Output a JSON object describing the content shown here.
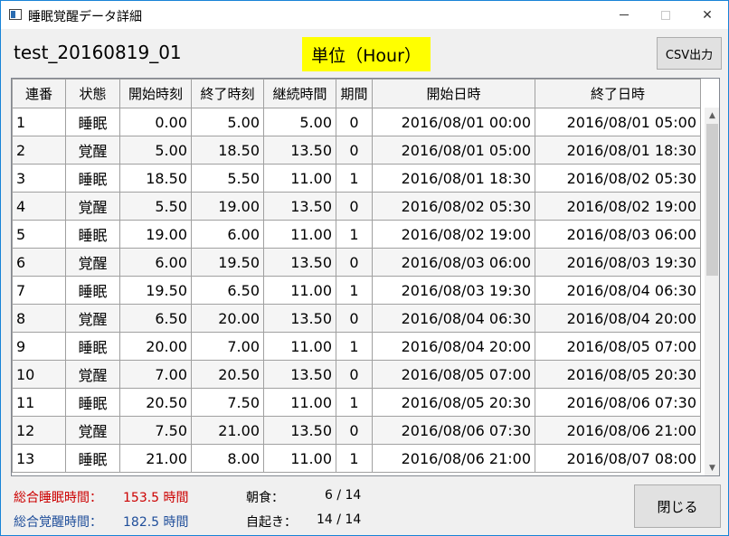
{
  "window": {
    "title": "睡眠覚醒データ詳細",
    "close_glyph": "✕"
  },
  "header": {
    "test_name": "test_20160819_01",
    "unit": "単位（Hour）",
    "csv_button": "CSV出力"
  },
  "table": {
    "columns": [
      "連番",
      "状態",
      "開始時刻",
      "終了時刻",
      "継続時間",
      "期間",
      "開始日時",
      "終了日時"
    ],
    "rows": [
      [
        "1",
        "睡眠",
        "0.00",
        "5.00",
        "5.00",
        "0",
        "2016/08/01 00:00",
        "2016/08/01 05:00"
      ],
      [
        "2",
        "覚醒",
        "5.00",
        "18.50",
        "13.50",
        "0",
        "2016/08/01 05:00",
        "2016/08/01 18:30"
      ],
      [
        "3",
        "睡眠",
        "18.50",
        "5.50",
        "11.00",
        "1",
        "2016/08/01 18:30",
        "2016/08/02 05:30"
      ],
      [
        "4",
        "覚醒",
        "5.50",
        "19.00",
        "13.50",
        "0",
        "2016/08/02 05:30",
        "2016/08/02 19:00"
      ],
      [
        "5",
        "睡眠",
        "19.00",
        "6.00",
        "11.00",
        "1",
        "2016/08/02 19:00",
        "2016/08/03 06:00"
      ],
      [
        "6",
        "覚醒",
        "6.00",
        "19.50",
        "13.50",
        "0",
        "2016/08/03 06:00",
        "2016/08/03 19:30"
      ],
      [
        "7",
        "睡眠",
        "19.50",
        "6.50",
        "11.00",
        "1",
        "2016/08/03 19:30",
        "2016/08/04 06:30"
      ],
      [
        "8",
        "覚醒",
        "6.50",
        "20.00",
        "13.50",
        "0",
        "2016/08/04 06:30",
        "2016/08/04 20:00"
      ],
      [
        "9",
        "睡眠",
        "20.00",
        "7.00",
        "11.00",
        "1",
        "2016/08/04 20:00",
        "2016/08/05 07:00"
      ],
      [
        "10",
        "覚醒",
        "7.00",
        "20.50",
        "13.50",
        "0",
        "2016/08/05 07:00",
        "2016/08/05 20:30"
      ],
      [
        "11",
        "睡眠",
        "20.50",
        "7.50",
        "11.00",
        "1",
        "2016/08/05 20:30",
        "2016/08/06 07:30"
      ],
      [
        "12",
        "覚醒",
        "7.50",
        "21.00",
        "13.50",
        "0",
        "2016/08/06 07:30",
        "2016/08/06 21:00"
      ],
      [
        "13",
        "睡眠",
        "21.00",
        "8.00",
        "11.00",
        "1",
        "2016/08/06 21:00",
        "2016/08/07 08:00"
      ]
    ]
  },
  "summary": {
    "sleep_label": "総合睡眠時間：",
    "sleep_value": "153.5 時間",
    "awake_label": "総合覚醒時間：",
    "awake_value": "182.5 時間",
    "breakfast_label": "朝食：",
    "breakfast_value": "6 / 14",
    "wake_label": "自起き：",
    "wake_value": "14 / 14"
  },
  "footer": {
    "close_button": "閉じる"
  },
  "colors": {
    "unit_highlight": "#ffff00",
    "sleep_text": "#cc0000",
    "awake_text": "#1f4e9a",
    "window_border": "#1883d7"
  },
  "icons": {
    "app": "window-icon",
    "minimize": "minimize-icon",
    "maximize": "maximize-icon",
    "close": "close-icon",
    "scroll_up": "chevron-up-icon",
    "scroll_down": "chevron-down-icon"
  }
}
